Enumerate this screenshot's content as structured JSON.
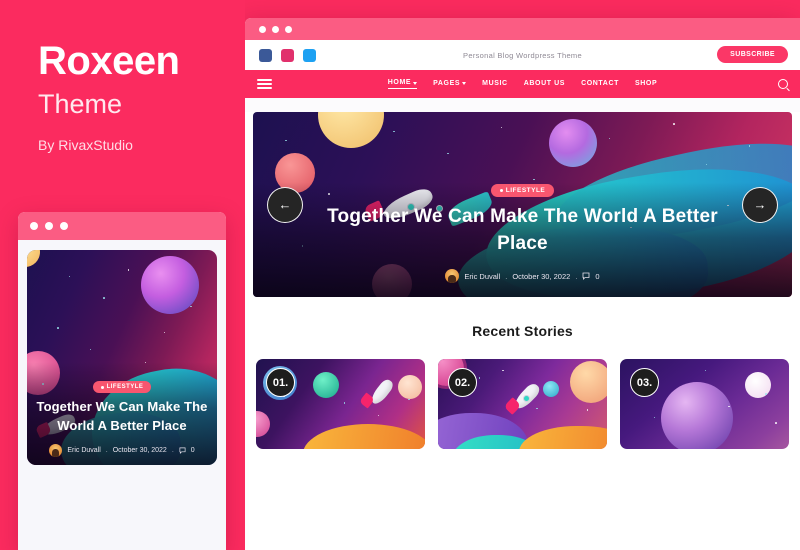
{
  "promo": {
    "brand_title": "Roxeen",
    "brand_subtitle": "Theme",
    "brand_author": "By RivaxStudio"
  },
  "colors": {
    "brand_pink": "#FB2B5F",
    "chrome_pink": "#FB5C83",
    "badge_pink": "#F8566F",
    "highlight_pink": "#FDD3DD",
    "dark_circle": "#1D1D1D"
  },
  "mobile_mockup": {
    "window_dots": [
      "dot-red",
      "dot-yellow",
      "dot-green"
    ],
    "card": {
      "badge": "LIFESTYLE",
      "title": "Together We Can Make The World A Better Place",
      "author": "Eric Duvall",
      "date": "October 30, 2022",
      "comments": "0",
      "separator": "."
    }
  },
  "browser": {
    "window_dots": [
      "dot-1",
      "dot-2",
      "dot-3"
    ],
    "topbar": {
      "tagline": "Personal Blog Wordpress Theme",
      "subscribe_label": "SUBSCRIBE",
      "social": [
        {
          "name": "facebook-icon",
          "color": "#3b5998"
        },
        {
          "name": "instagram-icon",
          "color": "#e1306c"
        },
        {
          "name": "twitter-icon",
          "color": "#1da1f2"
        }
      ]
    },
    "nav": {
      "hamburger": "menu-icon",
      "search": "search-icon",
      "items": [
        {
          "label": "HOME",
          "has_dropdown": true,
          "active": true
        },
        {
          "label": "PAGES",
          "has_dropdown": true,
          "active": false
        },
        {
          "label": "MUSIC",
          "has_dropdown": false,
          "active": false
        },
        {
          "label": "ABOUT US",
          "has_dropdown": false,
          "active": false
        },
        {
          "label": "CONTACT",
          "has_dropdown": false,
          "active": false
        },
        {
          "label": "SHOP",
          "has_dropdown": false,
          "active": false
        }
      ]
    },
    "hero": {
      "badge": "LIFESTYLE",
      "title": "Together We Can Make The World A Better Place",
      "author": "Eric Duvall",
      "date": "October 30, 2022",
      "comments": "0",
      "separator": ".",
      "prev_arrow": "←",
      "next_arrow": "→"
    },
    "recent": {
      "heading": "Recent Stories",
      "cards": [
        {
          "number": "01."
        },
        {
          "number": "02."
        },
        {
          "number": "03."
        }
      ]
    }
  }
}
